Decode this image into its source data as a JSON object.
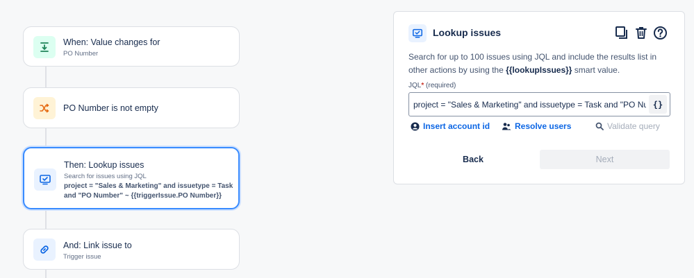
{
  "rule_chain": {
    "trigger": {
      "title": "When: Value changes for",
      "subtitle": "PO Number",
      "icon": "field-change-icon",
      "color": "#1f845a"
    },
    "condition": {
      "title": "PO Number is not empty",
      "icon": "shuffle-icon",
      "color": "#e56910"
    },
    "action_lookup": {
      "title": "Then: Lookup issues",
      "subtitle": "Search for issues using JQL",
      "detail": "project = \"Sales & Marketing\" and issuetype = Task and \"PO Number\" ~ {{triggerIssue.PO Number}}",
      "icon": "monitor-check-icon",
      "color": "#0c66e4"
    },
    "branch_link": {
      "title": "And: Link issue to",
      "subtitle": "Trigger issue",
      "icon": "link-icon",
      "color": "#0c66e4"
    }
  },
  "panel": {
    "title": "Lookup issues",
    "description_prefix": "Search for up to 100 issues using JQL and include the results list in other actions by using the ",
    "description_bold": "{{lookupIssues}}",
    "description_suffix": " smart value.",
    "jql_label": "JQL",
    "jql_required": "*",
    "jql_required_text": "(required)",
    "jql_value": "project = \"Sales & Marketing\" and issuetype = Task and \"PO Number\" ~ {{triggerIssue.PO Number}}",
    "brace_button": "{}",
    "insert_account_id": "Insert account id",
    "resolve_users": "Resolve users",
    "validate_query": "Validate query",
    "back_label": "Back",
    "next_label": "Next"
  }
}
